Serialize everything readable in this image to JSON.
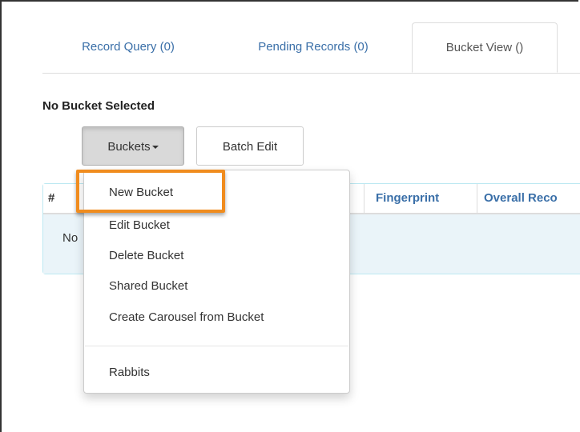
{
  "tabs": [
    {
      "label": "Record Query (0)"
    },
    {
      "label": "Pending Records (0)"
    },
    {
      "label": "Bucket View ()"
    }
  ],
  "bucket_status": "No Bucket Selected",
  "toolbar": {
    "buckets_label": "Buckets",
    "batch_edit_label": "Batch Edit"
  },
  "table": {
    "columns": [
      "#",
      "Fingerprint",
      "Overall Reco"
    ],
    "empty_text": "No"
  },
  "buckets_menu": {
    "items": [
      "New Bucket",
      "Edit Bucket",
      "Delete Bucket",
      "Shared Bucket",
      "Create Carousel from Bucket",
      "Rabbits"
    ],
    "highlighted": "New Bucket"
  },
  "colors": {
    "link": "#3a6fa8",
    "highlight": "#f08c1e",
    "table_border": "#bce8f1",
    "empty_row_bg": "#eaf4f9"
  }
}
